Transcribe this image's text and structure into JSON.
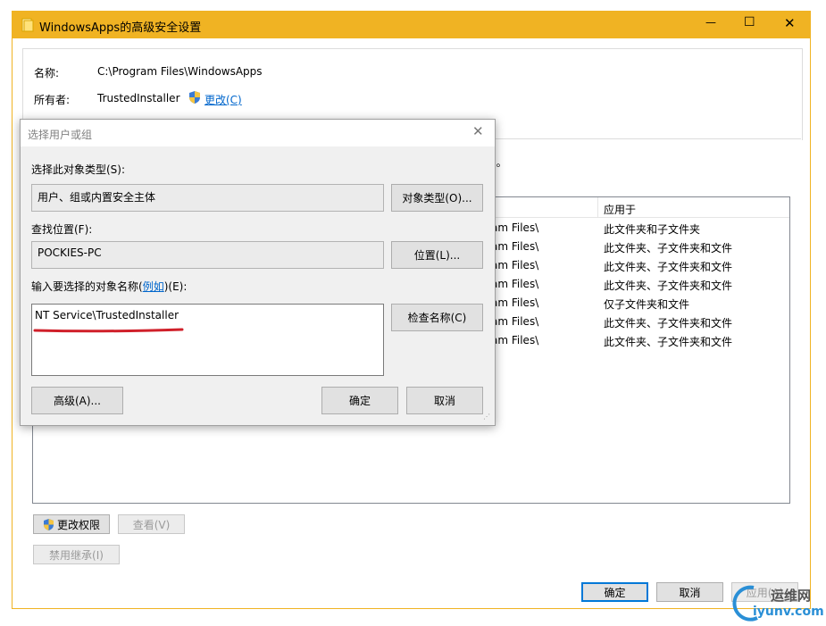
{
  "window": {
    "title": "WindowsApps的高级安全设置",
    "controls": {
      "minimize": "—",
      "maximize": "☐",
      "close": "✕"
    },
    "border_color": "#f0b323"
  },
  "info": {
    "name_label": "名称:",
    "name_value": "C:\\Program Files\\WindowsApps",
    "owner_label": "所有者:",
    "owner_value": "TrustedInstaller",
    "owner_change_link": "更改(C)"
  },
  "background_fragments": {
    "paren_text": ")。",
    "applies_to_header": "应用于",
    "rows": [
      {
        "path": "am Files\\",
        "applies": "此文件夹和子文件夹"
      },
      {
        "path": "am Files\\",
        "applies": "此文件夹、子文件夹和文件"
      },
      {
        "path": "am Files\\",
        "applies": "此文件夹、子文件夹和文件"
      },
      {
        "path": "am Files\\",
        "applies": "此文件夹、子文件夹和文件"
      },
      {
        "path": "am Files\\",
        "applies": "仅子文件夹和文件"
      },
      {
        "path": "am Files\\",
        "applies": "此文件夹、子文件夹和文件"
      },
      {
        "path": "am Files\\",
        "applies": "此文件夹、子文件夹和文件"
      }
    ]
  },
  "bottom_buttons": {
    "change_permissions": "更改权限",
    "view": "查看(V)",
    "disable_inheritance": "禁用继承(I)",
    "ok": "确定",
    "cancel": "取消",
    "apply": "应用(A)"
  },
  "dialog": {
    "title": "选择用户或组",
    "object_type_label": "选择此对象类型(S):",
    "object_type_value": "用户、组或内置安全主体",
    "object_type_button": "对象类型(O)...",
    "location_label": "查找位置(F):",
    "location_value": "POCKIES-PC",
    "location_button": "位置(L)...",
    "enter_label_pre": "输入要选择的对象名称(",
    "enter_label_link": "例如",
    "enter_label_post": ")(E):",
    "object_name_value": "NT Service\\TrustedInstaller",
    "check_names_button": "检查名称(C)",
    "advanced_button": "高级(A)...",
    "ok_button": "确定",
    "cancel_button": "取消",
    "underline_color": "#d0202a"
  },
  "watermark": {
    "brand_cn": "运维网",
    "brand_url": "iyunv.com"
  }
}
